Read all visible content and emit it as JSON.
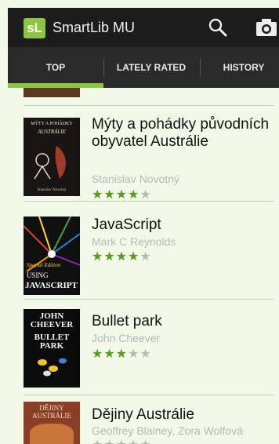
{
  "app": {
    "logo_text": "sL",
    "title": "SmartLib MU",
    "accent_color": "#8cc63f",
    "actions": [
      {
        "name": "search-icon"
      },
      {
        "name": "camera-icon"
      }
    ]
  },
  "tabs": [
    {
      "label": "TOP",
      "selected": true
    },
    {
      "label": "LATELY RATED",
      "selected": false
    },
    {
      "label": "HISTORY",
      "selected": false
    }
  ],
  "books": [
    {
      "title": "Mýty a pohádky původních obyvatel Austrálie",
      "author": "Stanislav Novotný",
      "rating": 4,
      "rating_max": 5,
      "cover": {
        "line1": "MÝTY A POHÁDKY",
        "line2": "AUSTRÁLIE",
        "caption": "Stanislav Novotný"
      }
    },
    {
      "title": "JavaScript",
      "author": "Mark C Reynolds",
      "rating": 4,
      "rating_max": 5,
      "cover": {
        "line1": "Special Edition",
        "line2": "USING",
        "line3": "JAVASCRIPT"
      }
    },
    {
      "title": "Bullet park",
      "author": "John Cheever",
      "rating": 3,
      "rating_max": 5,
      "cover": {
        "line1": "JOHN",
        "line2": "CHEEVER",
        "line3": "BULLET",
        "line4": "PARK"
      }
    },
    {
      "title": "Dějiny Austrálie",
      "author": "Geoffrey Blainey, Zora Wolfová",
      "rating": 0,
      "rating_max": 5,
      "cover": {
        "line1": "DĚJINY",
        "line2": "AUSTRÁLIE"
      }
    }
  ]
}
